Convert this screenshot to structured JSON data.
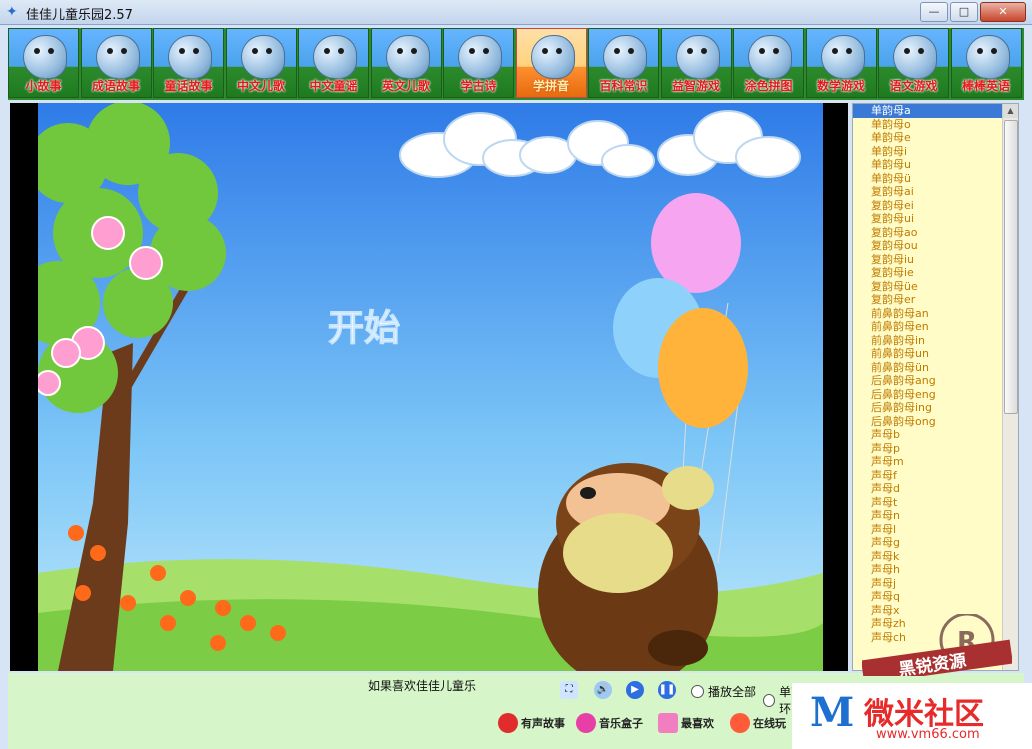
{
  "window": {
    "title": "佳佳儿童乐园2.57"
  },
  "tabs": [
    {
      "label": "小故事",
      "active": false
    },
    {
      "label": "成语故事",
      "active": false
    },
    {
      "label": "童话故事",
      "active": false
    },
    {
      "label": "中文儿歌",
      "active": false
    },
    {
      "label": "中文童谣",
      "active": false
    },
    {
      "label": "英文儿歌",
      "active": false
    },
    {
      "label": "学古诗",
      "active": false
    },
    {
      "label": "学拼音",
      "active": true
    },
    {
      "label": "百科常识",
      "active": false
    },
    {
      "label": "益智游戏",
      "active": false
    },
    {
      "label": "涂色拼图",
      "active": false
    },
    {
      "label": "数学游戏",
      "active": false
    },
    {
      "label": "语文游戏",
      "active": false
    },
    {
      "label": "棒棒英语",
      "active": false
    }
  ],
  "stage": {
    "start_label": "开始"
  },
  "sidebar": {
    "items": [
      "单韵母a",
      "单韵母o",
      "单韵母e",
      "单韵母i",
      "单韵母u",
      "单韵母ü",
      "复韵母ai",
      "复韵母ei",
      "复韵母ui",
      "复韵母ao",
      "复韵母ou",
      "复韵母iu",
      "复韵母ie",
      "复韵母üe",
      "复韵母er",
      "前鼻韵母an",
      "前鼻韵母en",
      "前鼻韵母in",
      "前鼻韵母un",
      "前鼻韵母ün",
      "后鼻韵母ang",
      "后鼻韵母eng",
      "后鼻韵母ing",
      "后鼻韵母ong",
      "声母b",
      "声母p",
      "声母m",
      "声母f",
      "声母d",
      "声母t",
      "声母n",
      "声母l",
      "声母g",
      "声母k",
      "声母h",
      "声母j",
      "声母q",
      "声母x",
      "声母zh",
      "声母ch"
    ],
    "selected_index": 0
  },
  "bottom": {
    "status": "如果喜欢佳佳儿童乐",
    "radio_all": "播放全部",
    "radio_single": "单首循环",
    "links": [
      "有声故事",
      "音乐盒子",
      "最喜欢",
      "在线玩"
    ]
  },
  "watermark": {
    "logo": "M",
    "text": "微米社区",
    "url": "www.vm66.com",
    "stamp": "黑锐资源"
  },
  "colors": {
    "tab_bar": "#2d8a2d",
    "tab_label": "#e21b1b",
    "list_text": "#c07a00",
    "selection": "#3a79d6",
    "sidebar_bg": "#fffcc8"
  }
}
